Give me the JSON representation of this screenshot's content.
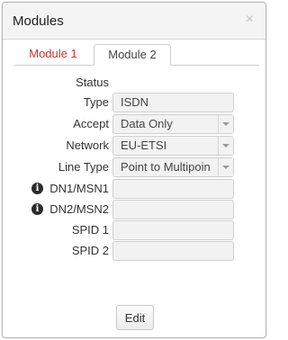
{
  "dialog": {
    "title": "Modules",
    "close_glyph": "×"
  },
  "tabs": [
    {
      "label": "Module 1",
      "active": false,
      "color": "#c23a34"
    },
    {
      "label": "Module 2",
      "active": true
    }
  ],
  "form": {
    "status_label": "Status",
    "type": {
      "label": "Type",
      "value": "ISDN"
    },
    "accept": {
      "label": "Accept",
      "value": "Data Only"
    },
    "network": {
      "label": "Network",
      "value": "EU-ETSI"
    },
    "line_type": {
      "label": "Line Type",
      "value": "Point to Multipoin"
    },
    "dn1": {
      "label": "DN1/MSN1",
      "value": "",
      "icon": "info-icon"
    },
    "dn2": {
      "label": "DN2/MSN2",
      "value": "",
      "icon": "info-icon"
    },
    "spid1": {
      "label": "SPID 1",
      "value": ""
    },
    "spid2": {
      "label": "SPID 2",
      "value": ""
    }
  },
  "buttons": {
    "edit_label": "Edit"
  },
  "colors": {
    "tab_inactive": "#c23a34",
    "field_bg": "#f2f2f2"
  }
}
